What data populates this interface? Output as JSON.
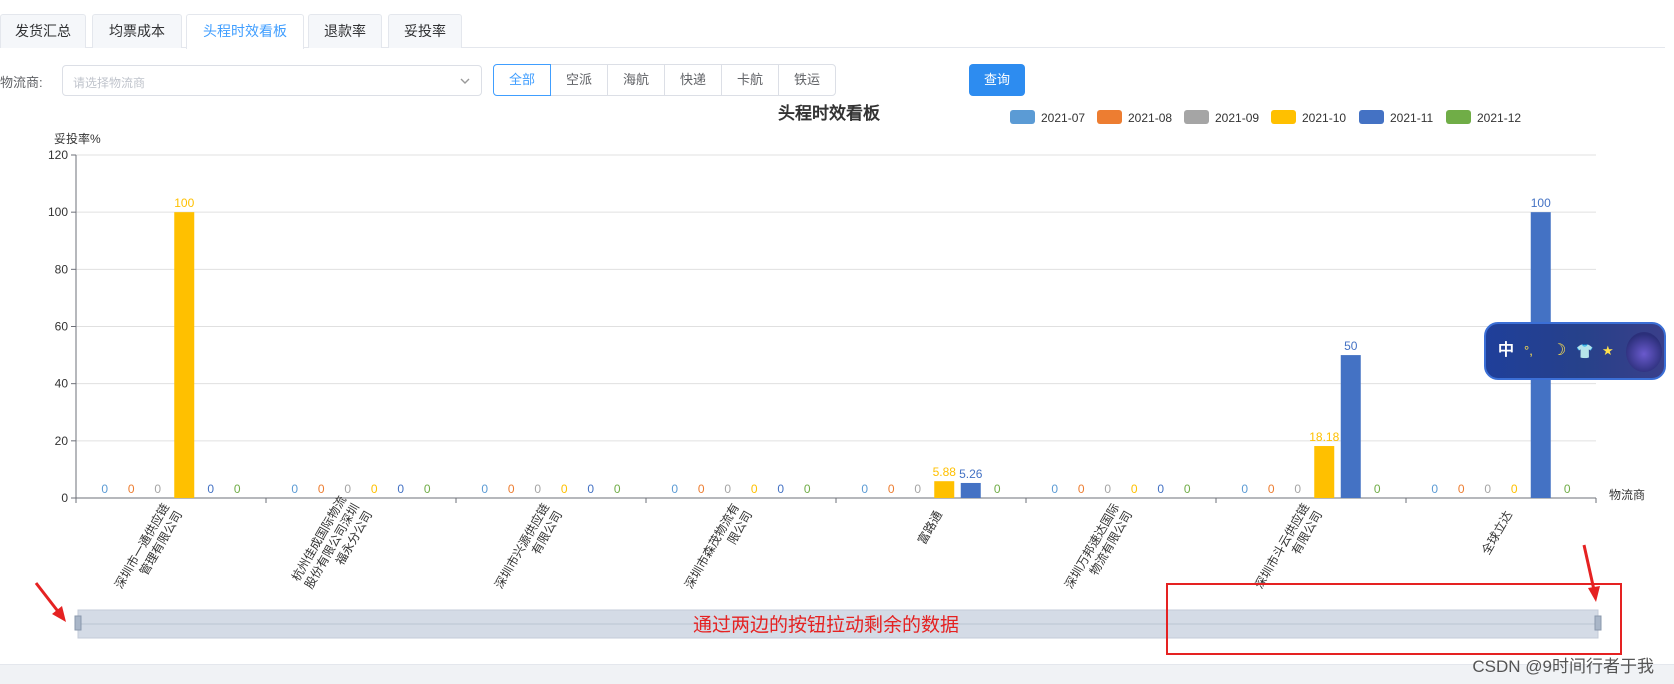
{
  "tabs": [
    {
      "label": "发货汇总",
      "active": false
    },
    {
      "label": "均票成本",
      "active": false
    },
    {
      "label": "头程时效看板",
      "active": true
    },
    {
      "label": "退款率",
      "active": false
    },
    {
      "label": "妥投率",
      "active": false
    }
  ],
  "filter": {
    "label": "物流商:",
    "placeholder": "请选择物流商",
    "segments": [
      {
        "label": "全部",
        "active": true
      },
      {
        "label": "空派",
        "active": false
      },
      {
        "label": "海航",
        "active": false
      },
      {
        "label": "快递",
        "active": false
      },
      {
        "label": "卡航",
        "active": false
      },
      {
        "label": "铁运",
        "active": false
      }
    ],
    "query_label": "查询"
  },
  "colors": {
    "accent": "#409eff",
    "query_button": "#2d8cf0",
    "annotation_red": "#e52222"
  },
  "chart_data": {
    "type": "bar",
    "title": "头程时效看板",
    "ylabel": "妥投率%",
    "xlabel": "物流商",
    "ylim": [
      0,
      120
    ],
    "yticks": [
      0,
      20,
      40,
      60,
      80,
      100,
      120
    ],
    "grid": true,
    "legend_position": "top-right",
    "categories": [
      [
        "深圳市一通供应链",
        "管理有限公司"
      ],
      [
        "杭州佳成国际物流",
        "股份有限公司深圳",
        "福永分公司"
      ],
      [
        "深圳市兴源供应链",
        "有限公司"
      ],
      [
        "深圳市森茂物流有",
        "限公司"
      ],
      [
        "富路通"
      ],
      [
        "深圳万邦速达国际",
        "物流有限公司"
      ],
      [
        "深圳市斗云供应链",
        "有限公司"
      ],
      [
        "全球立达"
      ]
    ],
    "series": [
      {
        "name": "2021-07",
        "color": "#5b9bd5",
        "values": [
          0,
          0,
          0,
          0,
          0,
          0,
          0,
          0
        ],
        "labels": [
          "0",
          "0",
          "0",
          "0",
          "0",
          "0",
          "0",
          "0"
        ]
      },
      {
        "name": "2021-08",
        "color": "#ed7d31",
        "values": [
          0,
          0,
          0,
          0,
          0,
          0,
          0,
          0
        ],
        "labels": [
          "0",
          "0",
          "0",
          "0",
          "0",
          "0",
          "0",
          "0"
        ]
      },
      {
        "name": "2021-09",
        "color": "#a5a5a5",
        "values": [
          0,
          0,
          0,
          0,
          0,
          0,
          0,
          0
        ],
        "labels": [
          "0",
          "0",
          "0",
          "0",
          "0",
          "0",
          "0",
          "0"
        ]
      },
      {
        "name": "2021-10",
        "color": "#ffc000",
        "values": [
          100,
          0,
          0,
          0,
          5.88,
          0,
          18.18,
          0
        ],
        "labels": [
          "100",
          "0",
          "0",
          "0",
          "5.88",
          "0",
          "18.18",
          "0"
        ]
      },
      {
        "name": "2021-11",
        "color": "#4472c4",
        "values": [
          0,
          0,
          0,
          0,
          5.26,
          0,
          50,
          100
        ],
        "labels": [
          "0",
          "0",
          "0",
          "0",
          "5.26",
          "0",
          "50",
          "100"
        ]
      },
      {
        "name": "2021-12",
        "color": "#70ad47",
        "values": [
          0,
          0,
          0,
          0,
          0,
          0,
          0,
          0
        ],
        "labels": [
          "0",
          "0",
          "0",
          "0",
          "0",
          "0",
          "0",
          "0"
        ]
      }
    ],
    "annotation": "通过两边的按钮拉动剩余的数据"
  },
  "widget": {
    "zh": "中",
    "icons": [
      "°,",
      "☽",
      "👕",
      "★"
    ]
  },
  "watermark": "CSDN @9时间行者于我"
}
